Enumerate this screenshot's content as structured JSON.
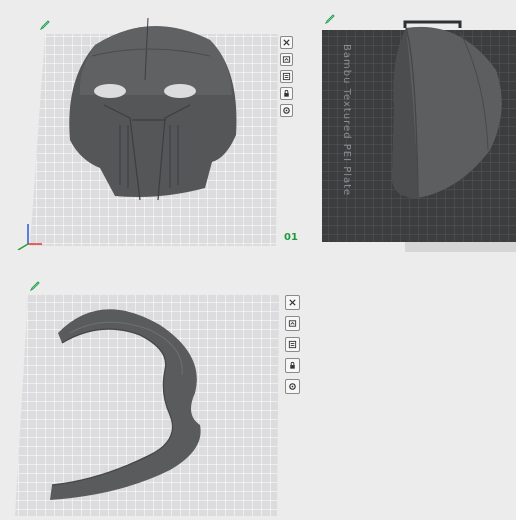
{
  "views": [
    {
      "id": "plate-1",
      "plate_number": "01",
      "object": "mask-front",
      "selected": false
    },
    {
      "id": "plate-2",
      "plate_label": "Bambu Textured PEI Plate",
      "object": "helmet-side-piece",
      "selected": true
    },
    {
      "id": "plate-3",
      "object": "mask-ring-piece",
      "selected": false
    }
  ],
  "toolbar_icons": [
    "close-icon",
    "arrange-icon",
    "orient-icon",
    "lock-icon",
    "settings-icon"
  ],
  "colors": {
    "plate_light": "#e2e2e4",
    "plate_dark": "#3b3d3f",
    "model": "#5b5b5b",
    "plate_number": "#1d9a3a",
    "edit_icon": "#22a24a"
  }
}
